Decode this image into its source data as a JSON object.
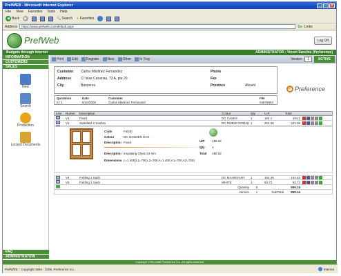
{
  "window": {
    "title": "PrefWEB - Microsoft Internet Explorer"
  },
  "menu": [
    "File",
    "View",
    "Favorites",
    "Tools",
    "Help"
  ],
  "toolbar": {
    "back": "Back",
    "search": "Search",
    "favorites": "Favorites"
  },
  "address": {
    "label": "Address",
    "value": "https://www.prefweb.com/default.aspx",
    "go": "Go",
    "links": "Links"
  },
  "header": {
    "logo": "PrefWeb",
    "logout": "Log Off"
  },
  "greenbar": {
    "left": "Budgets through Internet",
    "right": "ADMINISTRATOR : Vicent Sanchis (Preference)"
  },
  "sidebar": {
    "sections": [
      "INFORMATION",
      "CUSTOMERS",
      "SALES"
    ],
    "items": [
      {
        "label": "New",
        "color": "#4a7cc4"
      },
      {
        "label": "Search",
        "color": "#5a86c9"
      },
      {
        "label": "Production",
        "color": "#e7a51b"
      },
      {
        "label": "Locked Documents",
        "color": "#d6a530"
      }
    ],
    "bottom": [
      "FAQ",
      "ADMINISTRATION"
    ]
  },
  "actions": {
    "items": [
      "Print",
      "Edit",
      "Register",
      "New",
      "Other",
      "In Tray"
    ],
    "version_label": "Version",
    "version": "1",
    "status": "ACTIVE"
  },
  "customer": {
    "customer_label": "Customer",
    "customer": "Carlos Martinez Fernandez",
    "address_label": "Address",
    "address": "C/ Islas Canarias, 73 A, pta 20",
    "city_label": "City",
    "city": "Banyeres",
    "phone_label": "Phone",
    "fax_label": "Fax",
    "province_label": "Province",
    "province": "Alicant"
  },
  "info": {
    "headers": [
      "Quotation",
      "Date",
      "Customer",
      "FIN"
    ],
    "values": [
      "8 / 1",
      "5/10/2006",
      "Carlos Martinez Fernandez",
      "54878654"
    ]
  },
  "brand": {
    "name": "Preference"
  },
  "grid": {
    "headers": [
      "Line",
      "Numer.",
      "Description",
      "Colour",
      "Qty",
      "U.P.",
      "Total"
    ],
    "rows": [
      {
        "line": "",
        "num": "V1",
        "desc": "Fixed",
        "colour": "DC CASRA",
        "qty": "1",
        "up": "194.1",
        "total": "194.1"
      },
      {
        "line": "",
        "num": "V2",
        "desc": "Standard 2 Sashes",
        "colour": "DC ROBLE DORADO",
        "qty": "1",
        "up": "221.36",
        "total": "221.36"
      },
      {
        "line": "",
        "num": "",
        "desc": "",
        "colour": "",
        "qty": "",
        "up": "",
        "total": ""
      }
    ],
    "rows2": [
      {
        "num": "V4",
        "desc": "Folding 1 Sash",
        "colour": "DC MAHOGANY",
        "qty": "1",
        "up": "154.45",
        "total": "154.45"
      },
      {
        "num": "V5",
        "desc": "Folding 1 Sash",
        "colour": "WHITE",
        "qty": "1",
        "up": "93.73",
        "total": "93.73"
      }
    ]
  },
  "detail": {
    "code_label": "Code",
    "code": "F4540",
    "colour_label": "Colour",
    "colour": "DC GOLDEN OAK",
    "desc_label": "Description",
    "desc": "Fixed",
    "desc2_label": "Description",
    "desc2": "Insulating Glass 24 mm",
    "dims_label": "Dimensions",
    "dims": "L=1.400(L1=700,L2=700,A=1.400,A1=700,A2=700)",
    "up_label": "U/P",
    "up": "195.52",
    "qty_label": "Qty",
    "qty": "1",
    "total_label": "Total",
    "total": "195.52"
  },
  "totals": {
    "quantity_label": "Quantity",
    "quantity": "5",
    "total": "859.16",
    "version_label": "Version",
    "version": "1",
    "subtotal_label": "SubTotal",
    "subtotal": "859.16"
  },
  "footer": "Copyright 1994-2006 Preference S.L. All rights reserved",
  "statusbar": {
    "left": "PrefWEB :: Copyright 1994 - 2006, Preference S.L.",
    "right": "Internet"
  }
}
